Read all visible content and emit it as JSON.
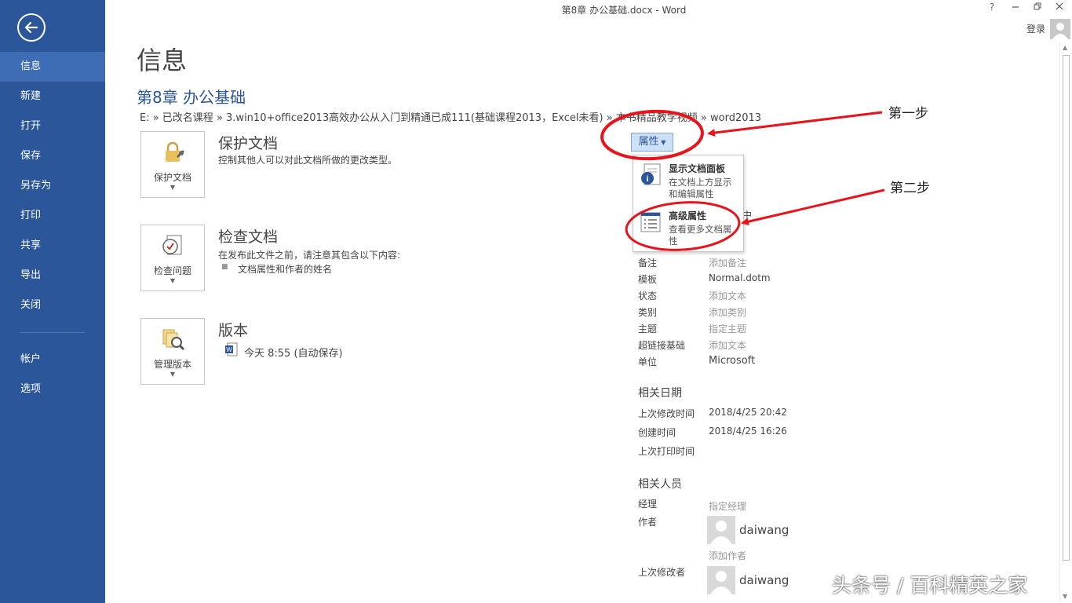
{
  "window": {
    "title": "第8章 办公基础.docx - Word",
    "help": "?",
    "login": "登录"
  },
  "sidebar": {
    "items": [
      {
        "label": "信息"
      },
      {
        "label": "新建"
      },
      {
        "label": "打开"
      },
      {
        "label": "保存"
      },
      {
        "label": "另存为"
      },
      {
        "label": "打印"
      },
      {
        "label": "共享"
      },
      {
        "label": "导出"
      },
      {
        "label": "关闭"
      }
    ],
    "bottom_items": [
      {
        "label": "帐户"
      },
      {
        "label": "选项"
      }
    ]
  },
  "main": {
    "heading": "信息",
    "doc_name": "第8章 办公基础",
    "path": "E: » 已改名课程 » 3.win10+office2013高效办公从入门到精通已成111(基础课程2013，Excel未看) » 本书精品教学视频 » word2013",
    "protect": {
      "button": "保护文档",
      "title": "保护文档",
      "desc": "控制其他人可以对此文档所做的更改类型。"
    },
    "inspect": {
      "button": "检查问题",
      "title": "检查文档",
      "desc": "在发布此文件之前，请注意其包含以下内容:",
      "bullet": "文档属性和作者的姓名"
    },
    "versions": {
      "button": "管理版本",
      "title": "版本",
      "entry": "今天 8:55 (自动保存)"
    }
  },
  "properties": {
    "button": "属性",
    "menu": [
      {
        "title": "显示文档面板",
        "desc": "在文档上方显示和编辑属性"
      },
      {
        "title": "高级属性",
        "desc": "查看更多文档属性"
      }
    ],
    "fields": [
      {
        "label": "备注",
        "value": "添加备注",
        "set": false
      },
      {
        "label": "模板",
        "value": "Normal.dotm",
        "set": true
      },
      {
        "label": "状态",
        "value": "添加文本",
        "set": false
      },
      {
        "label": "类别",
        "value": "添加类别",
        "set": false
      },
      {
        "label": "主题",
        "value": "指定主题",
        "set": false
      },
      {
        "label": "超链接基础",
        "value": "添加文本",
        "set": false
      },
      {
        "label": "单位",
        "value": "Microsoft",
        "set": true
      }
    ],
    "dates_heading": "相关日期",
    "dates": [
      {
        "label": "上次修改时间",
        "value": "2018/4/25 20:42"
      },
      {
        "label": "创建时间",
        "value": "2018/4/25 16:26"
      },
      {
        "label": "上次打印时间",
        "value": ""
      }
    ],
    "people_heading": "相关人员",
    "manager_label": "经理",
    "manager_value": "指定经理",
    "author_label": "作者",
    "author_name": "daiwang",
    "add_author": "添加作者",
    "last_modified_by_label": "上次修改者",
    "last_modified_by": "daiwang"
  },
  "annotations": {
    "step1": "第一步",
    "step2": "第二步",
    "watermark": "头条号 / 百科精英之家",
    "color": "#e8141b"
  },
  "colors": {
    "sidebar": "#2b579a",
    "sidebar_active": "#3e6db5",
    "accent": "#2b579a"
  }
}
